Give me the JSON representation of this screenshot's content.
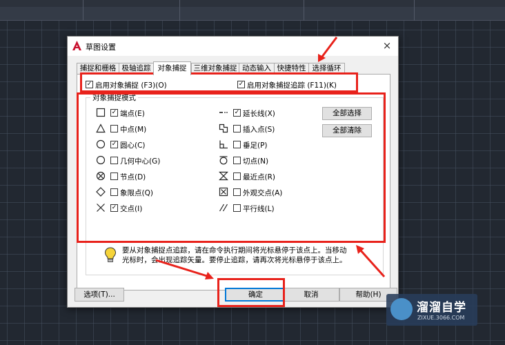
{
  "dialog": {
    "title": "草图设置",
    "close_glyph": "×",
    "tabs": [
      {
        "label": "捕捉和栅格"
      },
      {
        "label": "极轴追踪"
      },
      {
        "label": "对象捕捉",
        "active": true
      },
      {
        "label": "三维对象捕捉"
      },
      {
        "label": "动态输入"
      },
      {
        "label": "快捷特性"
      },
      {
        "label": "选择循环"
      }
    ],
    "enable_osnap": {
      "label": "启用对象捕捉 (F3)(O)",
      "checked": true
    },
    "enable_tracking": {
      "label": "启用对象捕捉追踪 (F11)(K)",
      "checked": true
    },
    "group_title": "对象捕捉模式",
    "modes": [
      {
        "label": "端点(E)",
        "icon": "endpoint-icon",
        "checked": true
      },
      {
        "label": "中点(M)",
        "icon": "midpoint-icon",
        "checked": false
      },
      {
        "label": "圆心(C)",
        "icon": "center-icon",
        "checked": true
      },
      {
        "label": "几何中心(G)",
        "icon": "geometric-center-icon",
        "checked": false
      },
      {
        "label": "节点(D)",
        "icon": "node-icon",
        "checked": false
      },
      {
        "label": "象限点(Q)",
        "icon": "quadrant-icon",
        "checked": false
      },
      {
        "label": "交点(I)",
        "icon": "intersection-icon",
        "checked": true
      },
      {
        "label": "延长线(X)",
        "icon": "extension-icon",
        "checked": true
      },
      {
        "label": "插入点(S)",
        "icon": "insertion-icon",
        "checked": false
      },
      {
        "label": "垂足(P)",
        "icon": "perpendicular-icon",
        "checked": false
      },
      {
        "label": "切点(N)",
        "icon": "tangent-icon",
        "checked": false
      },
      {
        "label": "最近点(R)",
        "icon": "nearest-icon",
        "checked": false
      },
      {
        "label": "外观交点(A)",
        "icon": "apparent-intersection-icon",
        "checked": false
      },
      {
        "label": "平行线(L)",
        "icon": "parallel-icon",
        "checked": false
      }
    ],
    "select_all_label": "全部选择",
    "clear_all_label": "全部清除",
    "hint_line1": "要从对象捕捉点追踪，请在命令执行期间将光标悬停于该点上。当移动",
    "hint_line2": "光标时，会出现追踪矢量。要停止追踪，请再次将光标悬停于该点上。",
    "options_label": "选项(T)...",
    "ok_label": "确定",
    "cancel_label": "取消",
    "help_label": "帮助(H)",
    "check_glyph": "✓"
  },
  "watermark": {
    "name": "溜溜自学",
    "url": "ZIXUE.3066.COM"
  },
  "colors": {
    "annotation": "#e8221b",
    "dialog_bg": "#f0f0f0",
    "canvas_bg": "#222831",
    "default_button_border": "#0078d7"
  }
}
